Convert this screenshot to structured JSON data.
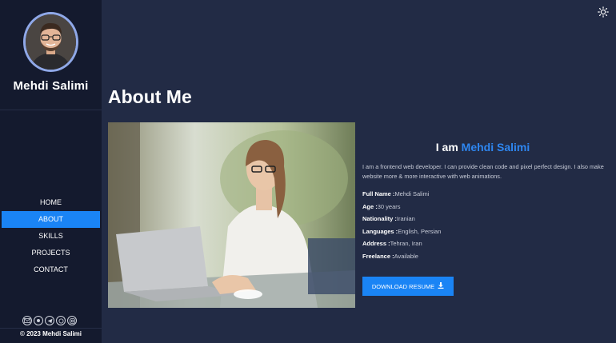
{
  "profile": {
    "name": "Mehdi Salimi"
  },
  "nav": {
    "items": [
      {
        "label": "HOME",
        "active": false
      },
      {
        "label": "ABOUT",
        "active": true
      },
      {
        "label": "SKILLS",
        "active": false
      },
      {
        "label": "PROJECTS",
        "active": false
      },
      {
        "label": "CONTACT",
        "active": false
      }
    ]
  },
  "socials": [
    "mail-icon",
    "github-icon",
    "telegram-icon",
    "whatsapp-icon",
    "instagram-icon"
  ],
  "footer": {
    "copyright": "© 2023 Mehdi Salimi"
  },
  "main": {
    "title": "About Me",
    "intro_prefix": "I am ",
    "intro_name": "Mehdi Salimi",
    "bio": "I am a frontend web developer. I can provide clean code and pixel perfect design. I also make website more & more interactive with web animations.",
    "details": [
      {
        "label": "Full Name :",
        "value": "Mehdi Salimi"
      },
      {
        "label": "Age :",
        "value": "30 years"
      },
      {
        "label": "Nationality :",
        "value": "Iranian"
      },
      {
        "label": "Languages :",
        "value": "English, Persian"
      },
      {
        "label": "Address :",
        "value": "Tehran, Iran"
      },
      {
        "label": "Freelance :",
        "value": "Available"
      }
    ],
    "download_label": "DOWNLOAD RESUME"
  },
  "colors": {
    "accent": "#1a84f5",
    "sidebar": "#141a2e",
    "background": "#222b45"
  }
}
